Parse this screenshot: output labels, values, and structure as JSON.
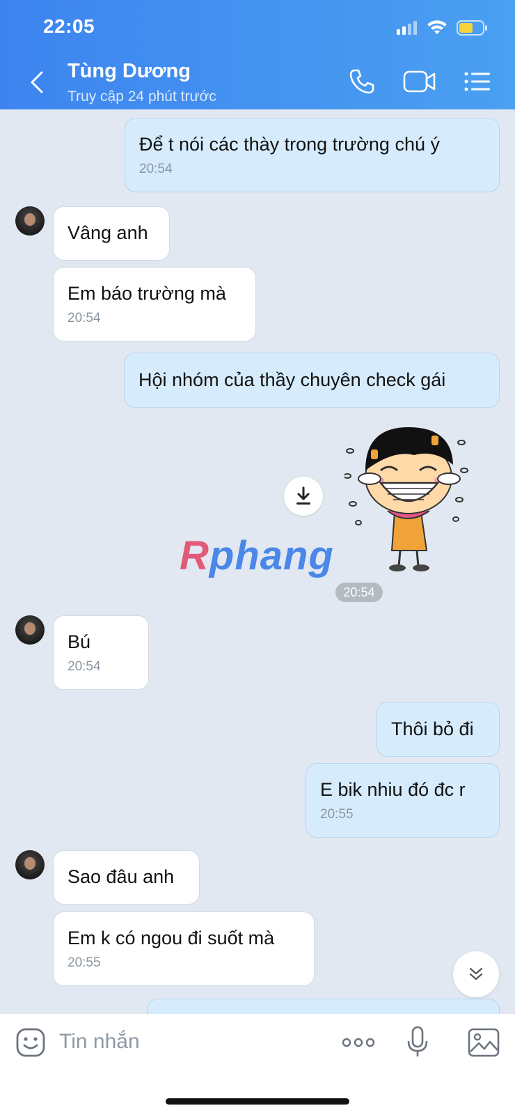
{
  "status_bar": {
    "time": "22:05"
  },
  "header": {
    "contact_name": "Tùng Dương",
    "contact_status": "Truy cập 24 phút trước"
  },
  "messages": [
    {
      "direction": "out",
      "text": "Để t nói các thày trong trường chú ý",
      "time": "20:54"
    },
    {
      "direction": "in",
      "text": "Vâng anh"
    },
    {
      "direction": "in",
      "text": "Em báo trường mà",
      "time": "20:54"
    },
    {
      "direction": "out",
      "text": "Hội nhóm của thầy chuyên check gái"
    },
    {
      "direction": "out",
      "type": "sticker",
      "watermark": "Rphang",
      "time": "20:54"
    },
    {
      "direction": "in",
      "text": "Bú",
      "time": "20:54"
    },
    {
      "direction": "out",
      "text": "Thôi bỏ đi"
    },
    {
      "direction": "out",
      "text": "E bik nhiu đó đc r",
      "time": "20:55"
    },
    {
      "direction": "in",
      "text": "Sao đâu anh"
    },
    {
      "direction": "in",
      "text": "Em k có ngou đi suốt mà",
      "time": "20:55"
    }
  ],
  "input": {
    "placeholder": "Tin nhắn"
  },
  "colors": {
    "header_start": "#3d84ef",
    "header_end": "#4aa0f1",
    "outgoing_bubble": "#d6ecfc",
    "incoming_bubble": "#ffffff",
    "background": "#e2e8f1"
  }
}
